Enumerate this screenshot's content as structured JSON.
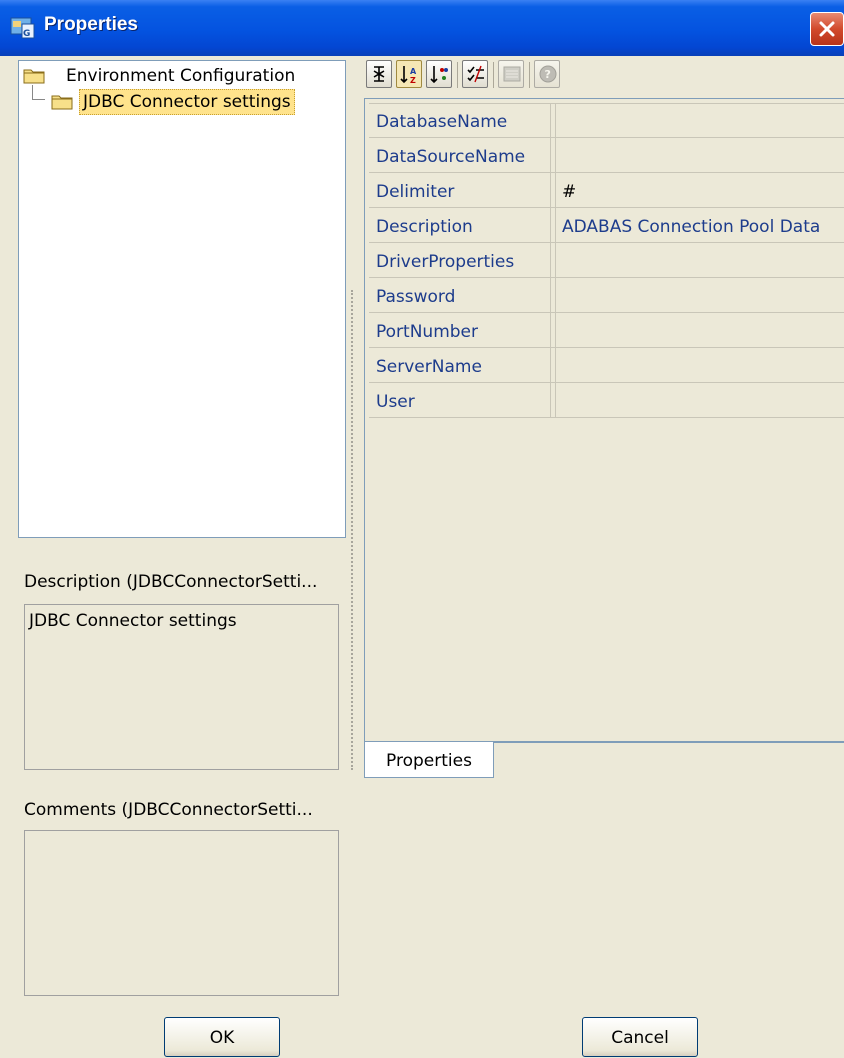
{
  "window": {
    "title": "Properties"
  },
  "tree": {
    "root_label": "Environment Configuration",
    "child_label": "JDBC Connector settings"
  },
  "description": {
    "label": "Description (JDBCConnectorSetti...",
    "text": "JDBC Connector settings"
  },
  "comments": {
    "label": "Comments (JDBCConnectorSetti...",
    "text": ""
  },
  "toolbar": {
    "buttons": [
      "sort-unsorted-icon",
      "sort-alphabetical-icon",
      "sort-by-category-icon",
      "show-editable-icon",
      "customize-icon",
      "help-icon"
    ]
  },
  "properties": [
    {
      "name": "DatabaseName",
      "value": ""
    },
    {
      "name": "DataSourceName",
      "value": ""
    },
    {
      "name": "Delimiter",
      "value": "#"
    },
    {
      "name": "Description",
      "value": "ADABAS Connection Pool Data"
    },
    {
      "name": "DriverProperties",
      "value": ""
    },
    {
      "name": "Password",
      "value": ""
    },
    {
      "name": "PortNumber",
      "value": ""
    },
    {
      "name": "ServerName",
      "value": ""
    },
    {
      "name": "User",
      "value": ""
    }
  ],
  "tabs": {
    "properties_label": "Properties"
  },
  "buttons": {
    "ok_label": "OK",
    "cancel_label": "Cancel"
  },
  "colors": {
    "titlebar": "#0453e0",
    "selection": "#ffe38c",
    "property_text": "#1d3c8c"
  }
}
